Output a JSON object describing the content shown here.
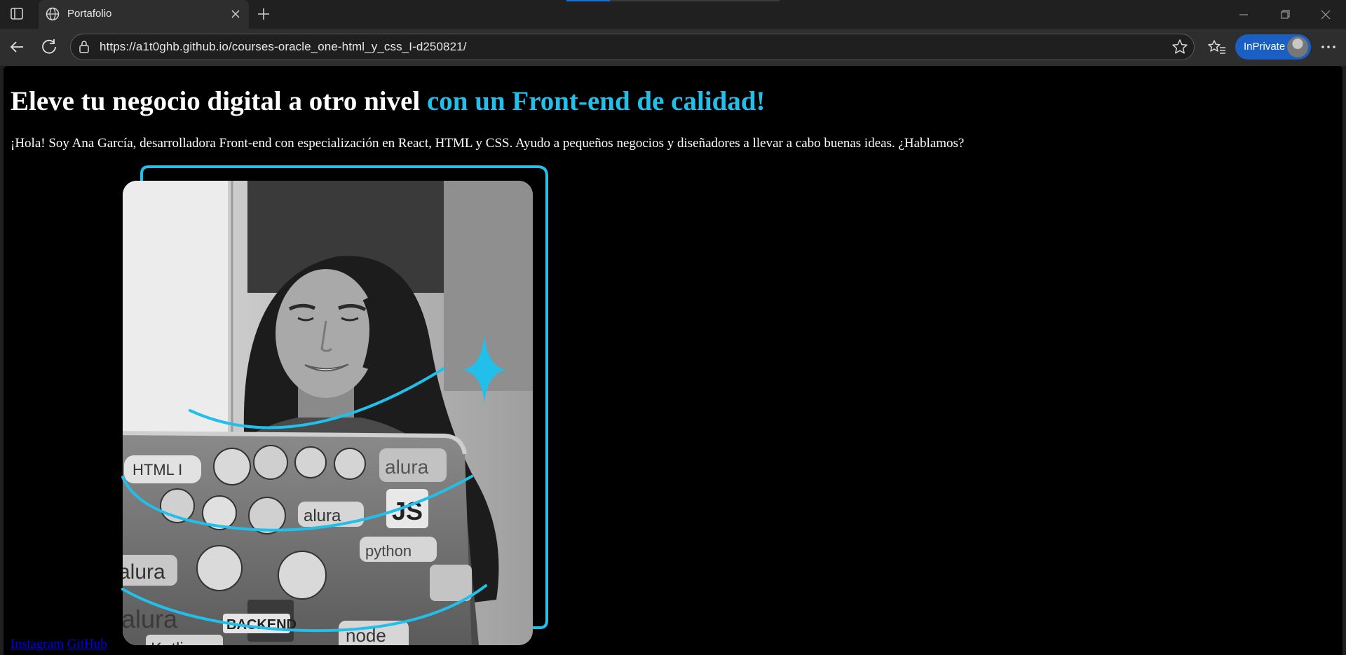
{
  "browser": {
    "tab_title": "Portafolio",
    "url": "https://a1t0ghb.github.io/courses-oracle_one-html_y_css_I-d250821/",
    "profile_label": "InPrivate",
    "colors": {
      "accent": "#1a5fc4",
      "chrome_bg": "#202020",
      "toolbar_bg": "#2e2e2e"
    }
  },
  "page": {
    "heading_main": "Eleve tu negocio digital a otro nivel ",
    "heading_highlight": "con un Front-end de calidad!",
    "intro": "¡Hola! Soy Ana García, desarrolladora Front-end con especialización en React, HTML y CSS. Ayudo a pequeños negocios y diseñadores a llevar a cabo buenas ideas. ¿Hablamos?",
    "hero_image_alt": "Foto de Ana García",
    "links": [
      {
        "label": "Instagram"
      },
      {
        "label": "GitHub"
      }
    ],
    "colors": {
      "background": "#000000",
      "highlight": "#22bfea",
      "link": "#0000ee"
    },
    "laptop_stickers": [
      "HTML I",
      "alura",
      "JS",
      "alura",
      "python",
      "alura",
      "BACKEND",
      "Kotlin",
      "node"
    ]
  }
}
